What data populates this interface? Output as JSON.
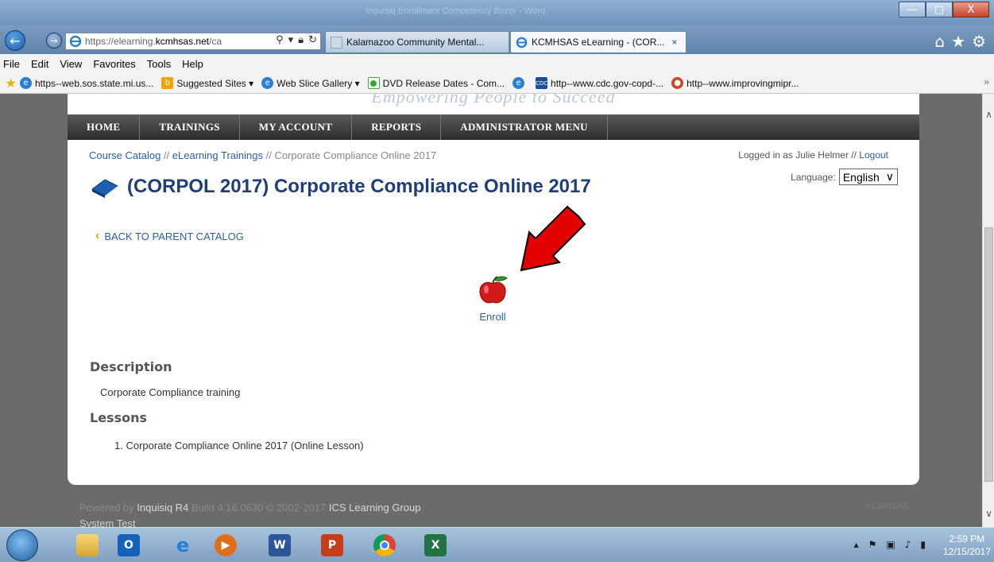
{
  "titlebar": {
    "ghost_text": "Inquisiq Enrollment Competency Bozer - Word",
    "minimize": "—",
    "maximize": "□",
    "close": "X"
  },
  "browser": {
    "url_gray_prefix": "https://elearning.",
    "url_host": "kcmhsas.net",
    "url_gray_suffix": "/ca",
    "tabs": [
      {
        "title": "Kalamazoo Community Mental...",
        "active": false
      },
      {
        "title": "KCMHSAS eLearning - (COR...",
        "active": true,
        "close": "×"
      }
    ],
    "menu": [
      "File",
      "Edit",
      "View",
      "Favorites",
      "Tools",
      "Help"
    ],
    "favorites": [
      {
        "label": "https--web.sos.state.mi.us...",
        "icon": "ie-page-icon"
      },
      {
        "label": "Suggested Sites ▾",
        "icon": "bing-icon"
      },
      {
        "label": "Web Slice Gallery ▾",
        "icon": "ie-page-icon"
      },
      {
        "label": "DVD Release Dates - Com...",
        "icon": "green-dot-icon"
      },
      {
        "label": "",
        "icon": "ie-page-icon"
      },
      {
        "label": "http--www.cdc.gov-copd-...",
        "icon": "cdc-icon"
      },
      {
        "label": "http--www.improvingmipr...",
        "icon": "site-icon"
      }
    ],
    "fav_more": "»"
  },
  "site": {
    "tagline": "Empowering People to Succeed",
    "nav": [
      "HOME",
      "TRAININGS",
      "MY ACCOUNT",
      "REPORTS",
      "ADMINISTRATOR MENU"
    ],
    "breadcrumb": {
      "link1": "Course Catalog",
      "sep": " // ",
      "link2": "eLearning Trainings",
      "current": "Corporate Compliance Online 2017"
    },
    "logged_in_prefix": "Logged in as Julie Helmer // ",
    "logout": "Logout",
    "language_label": "Language:",
    "language_value": "English",
    "course_title": "(CORPOL 2017) Corporate Compliance Online 2017",
    "back_link": "BACK TO PARENT CATALOG",
    "enroll_label": "Enroll",
    "description_heading": "Description",
    "description_text": "Corporate Compliance training",
    "lessons_heading": "Lessons",
    "lessons": [
      "1.  Corporate Compliance Online 2017 (Online Lesson)"
    ],
    "footer_powered": "Powered by ",
    "footer_product": "Inquisiq R4",
    "footer_build": " Build 4.16.0630  © 2002-2017  ",
    "footer_company": "ICS Learning Group",
    "footer_brand": "KCMHSAS",
    "footer_system": "System Test"
  },
  "taskbar": {
    "time": "2:59 PM",
    "date": "12/15/2017"
  },
  "colors": {
    "link": "#2c5ea8",
    "title": "#1e3f7a",
    "nav_bg": "#3a3a3a",
    "arrow": "#e30000"
  }
}
